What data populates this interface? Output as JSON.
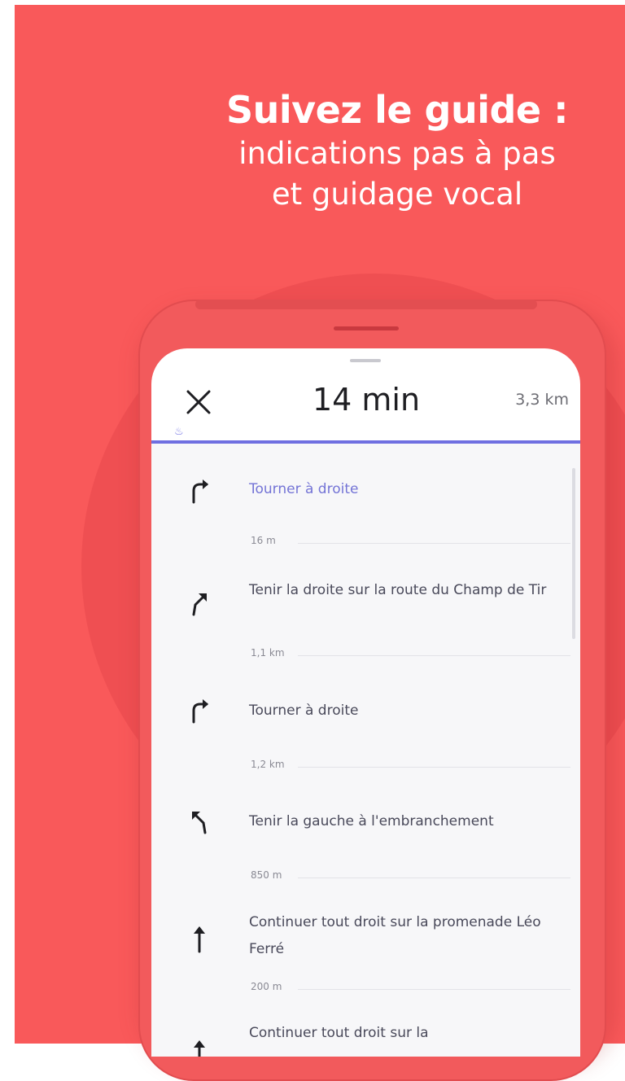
{
  "headline": {
    "title": "Suivez le guide :",
    "line1": "indications pas à pas",
    "line2": "et guidage vocal"
  },
  "nav": {
    "duration": "14 min",
    "distance": "3,3 km",
    "route_marker": "♨"
  },
  "steps": [
    {
      "instruction": "Tourner à droite",
      "distance": "16 m",
      "icon": "turn-right-icon",
      "active": true
    },
    {
      "instruction": "Tenir la droite sur la route du Champ de Tir",
      "distance": "1,1 km",
      "icon": "keep-right-icon",
      "active": false
    },
    {
      "instruction": "Tourner à droite",
      "distance": "1,2 km",
      "icon": "turn-right-icon",
      "active": false
    },
    {
      "instruction": "Tenir la gauche à l'embranchement",
      "distance": "850 m",
      "icon": "keep-left-icon",
      "active": false
    },
    {
      "instruction": "Continuer tout droit sur la promenade Léo Ferré",
      "distance": "200 m",
      "icon": "straight-arrow-icon",
      "active": false
    },
    {
      "instruction": "Continuer tout droit sur la",
      "distance": "",
      "icon": "straight-arrow-icon",
      "active": false
    }
  ],
  "colors": {
    "brand_red": "#f9595a",
    "accent_blue": "#6f6fe1"
  }
}
